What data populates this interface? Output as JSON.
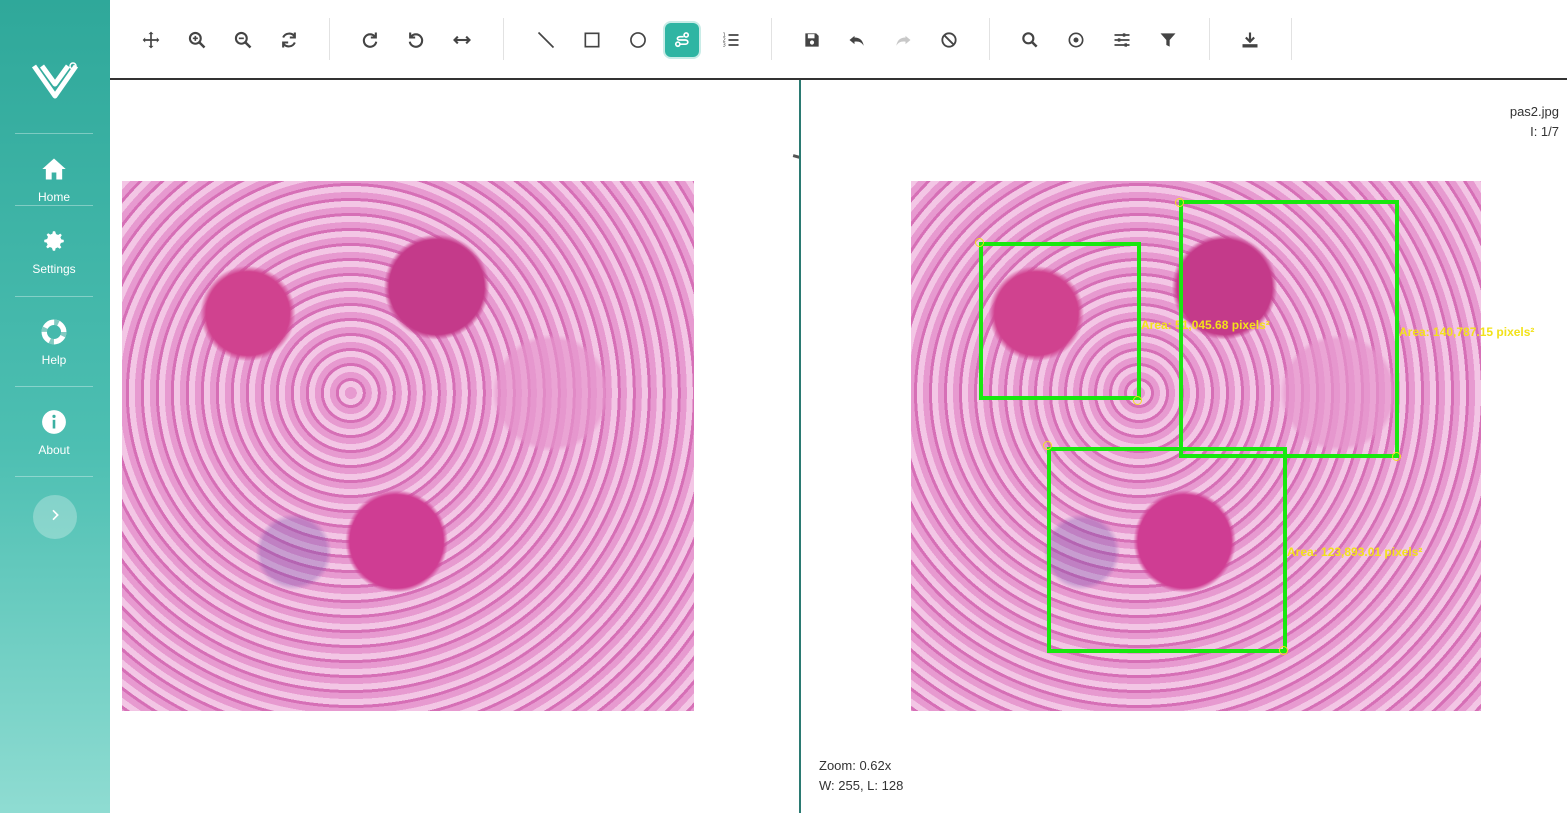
{
  "sidebar": {
    "items": [
      {
        "label": "Home",
        "icon": "home-icon"
      },
      {
        "label": "Settings",
        "icon": "gear-icon"
      },
      {
        "label": "Help",
        "icon": "lifebuoy-icon"
      },
      {
        "label": "About",
        "icon": "info-icon"
      }
    ],
    "expand_icon": "chevron-right-icon"
  },
  "toolbar": {
    "tools": [
      {
        "name": "pan",
        "icon": "move-arrows-icon"
      },
      {
        "name": "zoom-in",
        "icon": "zoom-in-icon"
      },
      {
        "name": "zoom-out",
        "icon": "zoom-out-icon"
      },
      {
        "name": "reset",
        "icon": "refresh-icon"
      },
      {
        "name": "rotate-right",
        "icon": "rotate-cw-icon"
      },
      {
        "name": "rotate-left",
        "icon": "rotate-ccw-icon"
      },
      {
        "name": "flip-horizontal",
        "icon": "flip-horizontal-icon"
      },
      {
        "name": "line",
        "icon": "line-icon"
      },
      {
        "name": "rectangle",
        "icon": "rectangle-icon"
      },
      {
        "name": "ellipse",
        "icon": "circle-icon"
      },
      {
        "name": "freehand",
        "icon": "freehand-path-icon",
        "active": true
      },
      {
        "name": "list",
        "icon": "numbered-list-icon"
      },
      {
        "name": "save",
        "icon": "save-icon"
      },
      {
        "name": "undo",
        "icon": "undo-icon"
      },
      {
        "name": "redo",
        "icon": "redo-icon",
        "disabled": true
      },
      {
        "name": "clear",
        "icon": "ban-icon"
      },
      {
        "name": "search",
        "icon": "magnify-icon"
      },
      {
        "name": "target",
        "icon": "target-icon"
      },
      {
        "name": "adjust",
        "icon": "sliders-icon"
      },
      {
        "name": "filter",
        "icon": "funnel-icon"
      },
      {
        "name": "download",
        "icon": "download-icon"
      }
    ]
  },
  "viewer": {
    "filename": "pas2.jpg",
    "image_index": "I: 1/7",
    "zoom": "Zoom: 0.62x",
    "window_level": "W: 255, L: 128",
    "annotations": [
      {
        "label": "Area: 51,045.68 pixels²"
      },
      {
        "label": "Area: 140,787.15 pixels²"
      },
      {
        "label": "Area: 123,893.01 pixels²"
      }
    ]
  },
  "colors": {
    "accent": "#2fb5a3",
    "roi": "#18e80f",
    "label": "#f2e21a"
  }
}
